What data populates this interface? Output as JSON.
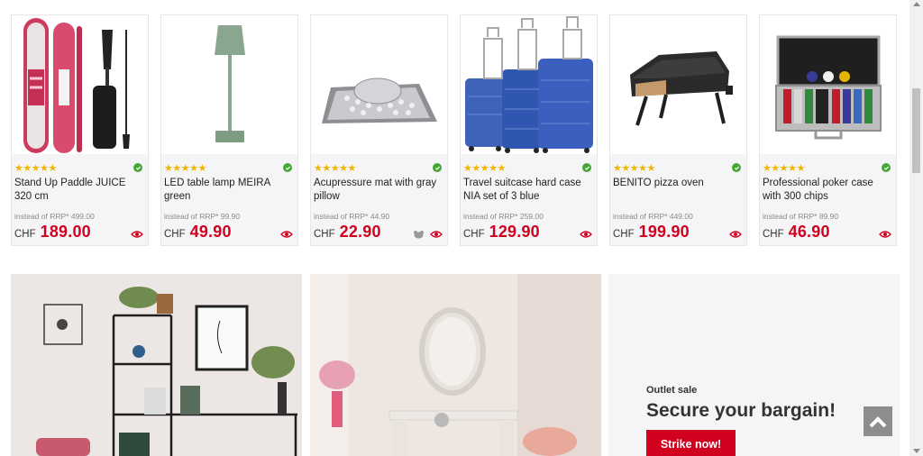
{
  "colors": {
    "accent": "#d0001e",
    "star": "#f2b600",
    "check": "#46a633",
    "price": "#d0001e"
  },
  "products": [
    {
      "name": "Stand Up Paddle JUICE 320 cm",
      "rating": 5,
      "stars": "★★★★★",
      "rrp": "instead of RRP* 499.00",
      "currency": "CHF",
      "price": "189.00",
      "icon": "eye-icon"
    },
    {
      "name": "LED table lamp MEIRA green",
      "rating": 5,
      "stars": "★★★★★",
      "rrp": "instead of RRP* 99.90",
      "currency": "CHF",
      "price": "49.90",
      "icon": "eye-icon"
    },
    {
      "name": "Acupressure mat with gray pillow",
      "rating": 5,
      "stars": "★★★★★",
      "rrp": "instead of RRP* 44.90",
      "currency": "CHF",
      "price": "22.90",
      "icon": "eye-icon"
    },
    {
      "name": "Travel suitcase hard case NIA set of 3 blue",
      "rating": 4.5,
      "stars": "★★★★★",
      "rrp": "instead of RRP* 259.00",
      "currency": "CHF",
      "price": "129.90",
      "icon": "eye-icon"
    },
    {
      "name": "BENITO pizza oven",
      "rating": 5,
      "stars": "★★★★★",
      "rrp": "instead of RRP* 449.00",
      "currency": "CHF",
      "price": "199.90",
      "icon": "eye-icon"
    },
    {
      "name": "Professional poker case with 300 chips",
      "rating": 5,
      "stars": "★★★★★",
      "rrp": "instead of RRP* 89.90",
      "currency": "CHF",
      "price": "46.90",
      "icon": "eye-icon"
    }
  ],
  "outlet": {
    "label": "Outlet sale",
    "title": "Secure your bargain!",
    "button": "Strike now!"
  }
}
